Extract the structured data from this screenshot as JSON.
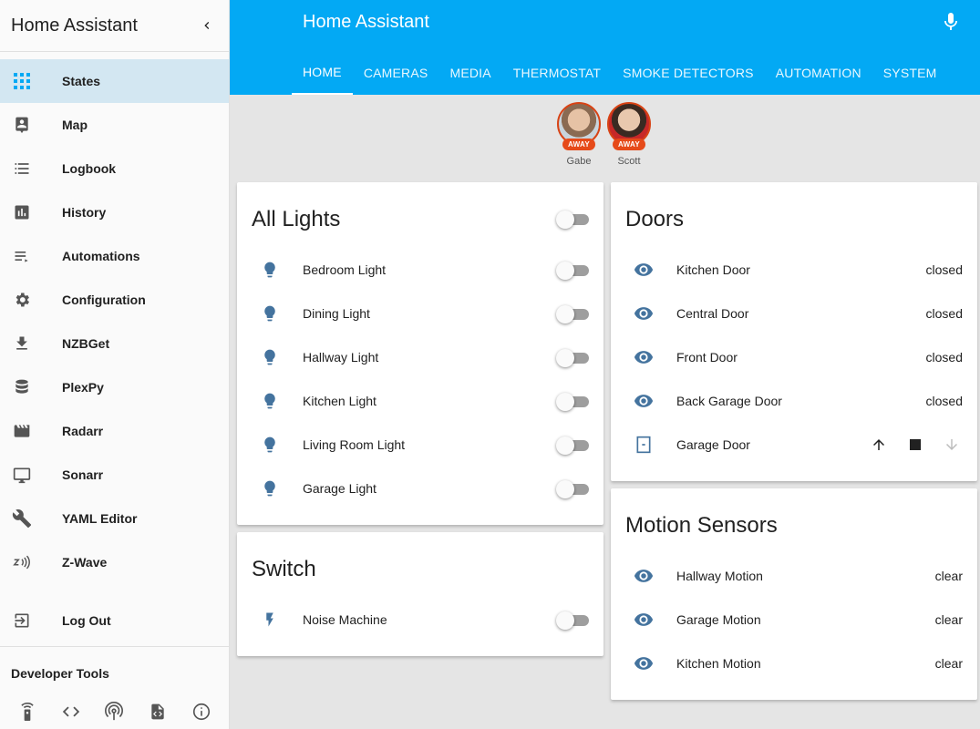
{
  "app_title": "Home Assistant",
  "sidebar": {
    "title": "Home Assistant",
    "items": [
      {
        "label": "States",
        "icon": "apps-grid-icon",
        "active": true
      },
      {
        "label": "Map",
        "icon": "account-location-icon"
      },
      {
        "label": "Logbook",
        "icon": "list-icon"
      },
      {
        "label": "History",
        "icon": "chart-bar-icon"
      },
      {
        "label": "Automations",
        "icon": "playlist-play-icon"
      },
      {
        "label": "Configuration",
        "icon": "gear-icon"
      },
      {
        "label": "NZBGet",
        "icon": "download-icon"
      },
      {
        "label": "PlexPy",
        "icon": "database-icon"
      },
      {
        "label": "Radarr",
        "icon": "movie-clapper-icon"
      },
      {
        "label": "Sonarr",
        "icon": "monitor-icon"
      },
      {
        "label": "YAML Editor",
        "icon": "wrench-icon"
      },
      {
        "label": "Z-Wave",
        "icon": "zwave-icon"
      }
    ],
    "logout_label": "Log Out",
    "dev_tools_title": "Developer Tools"
  },
  "header": {
    "title": "Home Assistant",
    "tabs": [
      "HOME",
      "CAMERAS",
      "MEDIA",
      "THERMOSTAT",
      "SMOKE DETECTORS",
      "AUTOMATION",
      "SYSTEM"
    ],
    "active_tab": "HOME"
  },
  "badges": [
    {
      "name": "Gabe",
      "label": "AWAY"
    },
    {
      "name": "Scott",
      "label": "AWAY"
    }
  ],
  "cards": {
    "lights": {
      "title": "All Lights",
      "rows": [
        "Bedroom Light",
        "Dining Light",
        "Hallway Light",
        "Kitchen Light",
        "Living Room Light",
        "Garage Light"
      ]
    },
    "switch": {
      "title": "Switch",
      "rows": [
        "Noise Machine"
      ]
    },
    "doors": {
      "title": "Doors",
      "rows": [
        {
          "name": "Kitchen Door",
          "state": "closed"
        },
        {
          "name": "Central Door",
          "state": "closed"
        },
        {
          "name": "Front Door",
          "state": "closed"
        },
        {
          "name": "Back Garage Door",
          "state": "closed"
        }
      ],
      "cover": {
        "name": "Garage Door"
      }
    },
    "motion": {
      "title": "Motion Sensors",
      "rows": [
        {
          "name": "Hallway Motion",
          "state": "clear"
        },
        {
          "name": "Garage Motion",
          "state": "clear"
        },
        {
          "name": "Kitchen Motion",
          "state": "clear"
        }
      ]
    }
  },
  "colors": {
    "accent": "#03a9f4",
    "icon_blue": "#44739e",
    "active_bg": "#d3e7f2",
    "away_badge": "#e64a19"
  }
}
